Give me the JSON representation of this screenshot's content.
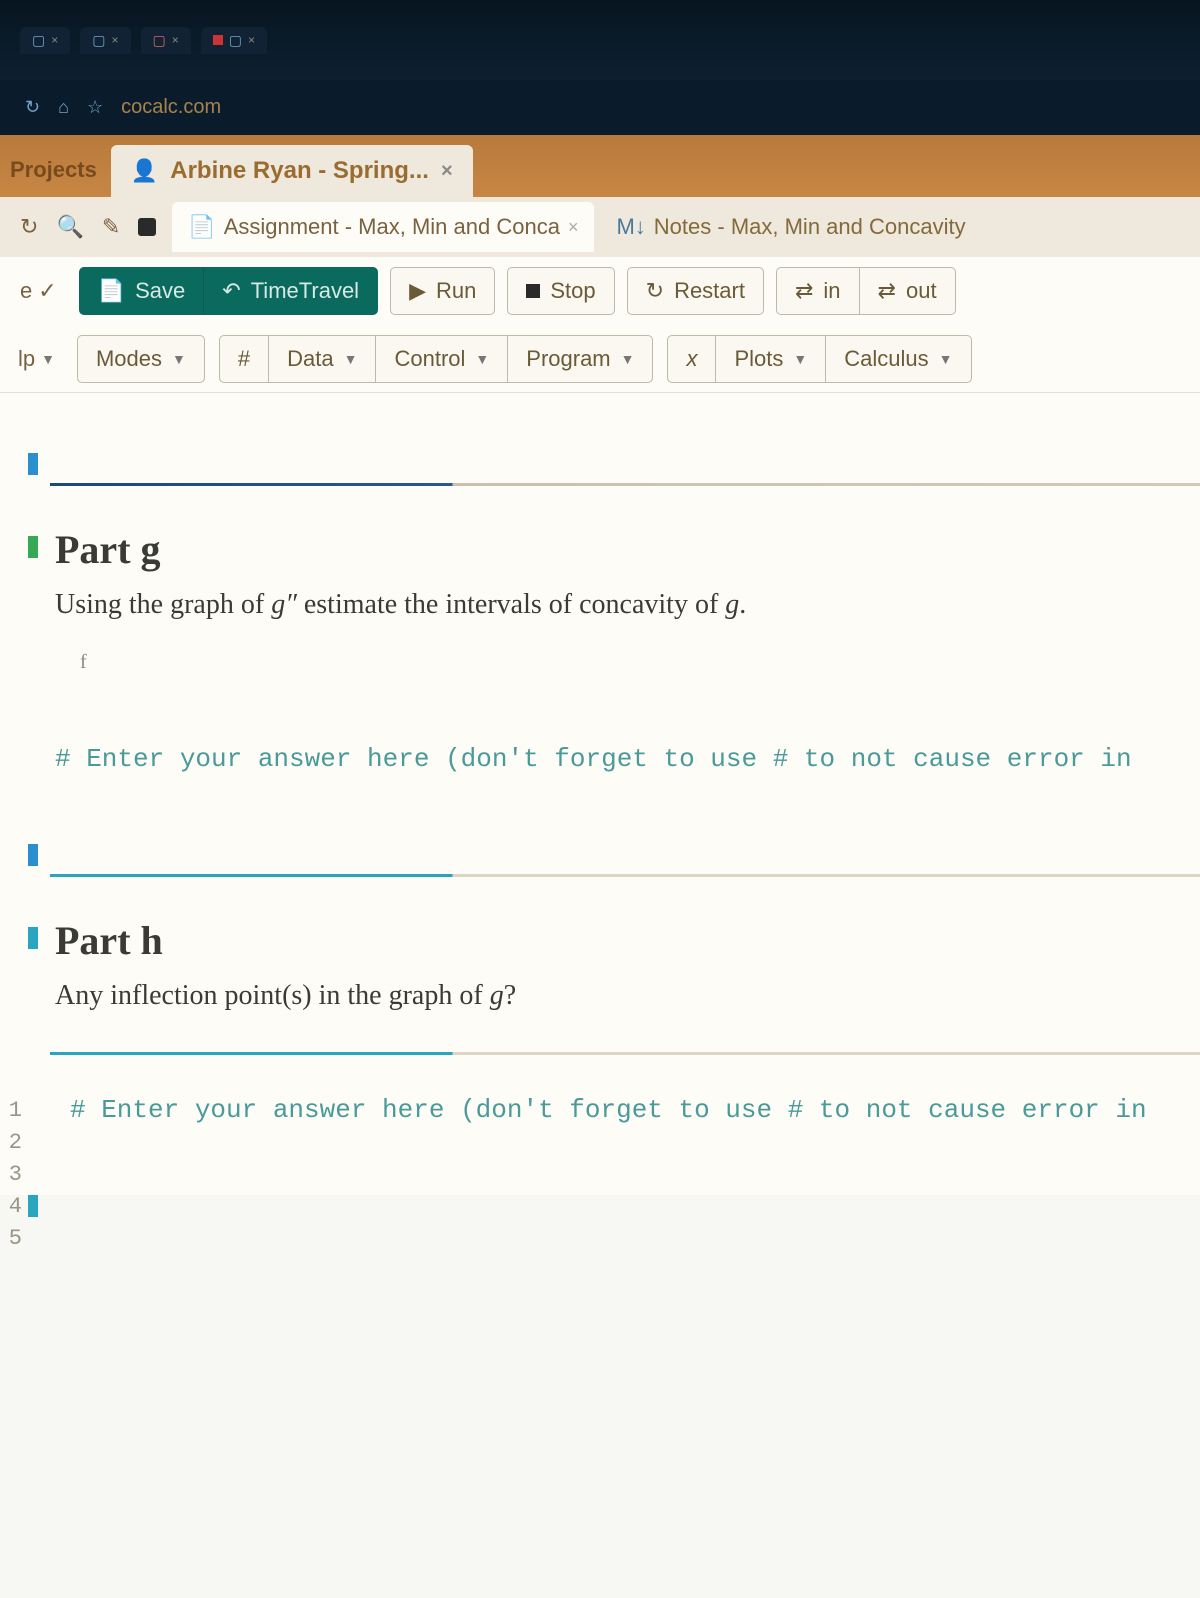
{
  "browser": {
    "tabs": [
      {
        "label": ""
      },
      {
        "label": ""
      },
      {
        "label": ""
      },
      {
        "label": ""
      }
    ],
    "url": "cocalc.com"
  },
  "app": {
    "projects_label": "Projects",
    "active_project": "Arbine Ryan - Spring..."
  },
  "files": {
    "icons": {},
    "active": "Assignment - Max, Min and Conca",
    "other": "Notes - Max, Min and Concavity"
  },
  "toolbar1": {
    "left": "e",
    "save": "Save",
    "timetravel": "TimeTravel",
    "run": "Run",
    "stop": "Stop",
    "restart": "Restart",
    "in": "in",
    "out": "out"
  },
  "toolbar2": {
    "left": "lp",
    "modes": "Modes",
    "hash": "#",
    "data": "Data",
    "control": "Control",
    "program": "Program",
    "x": "x",
    "plots": "Plots",
    "calculus": "Calculus"
  },
  "cells": {
    "g_title": "Part g",
    "g_text_a": "Using the graph of ",
    "g_text_math": "g″",
    "g_text_b": " estimate the intervals of concavity of ",
    "g_text_c": "g",
    "g_text_d": ".",
    "g_note": "f",
    "code_comment": "# Enter your answer here (don't forget to use # to not cause error in",
    "h_title": "Part h",
    "h_text_a": "Any inflection point(s) in the graph of ",
    "h_text_math": "g",
    "h_text_b": "?",
    "code_comment2": "# Enter your answer here (don't forget to use # to not cause error in",
    "gutter": [
      "1",
      "2",
      "3",
      "4",
      "5"
    ]
  }
}
